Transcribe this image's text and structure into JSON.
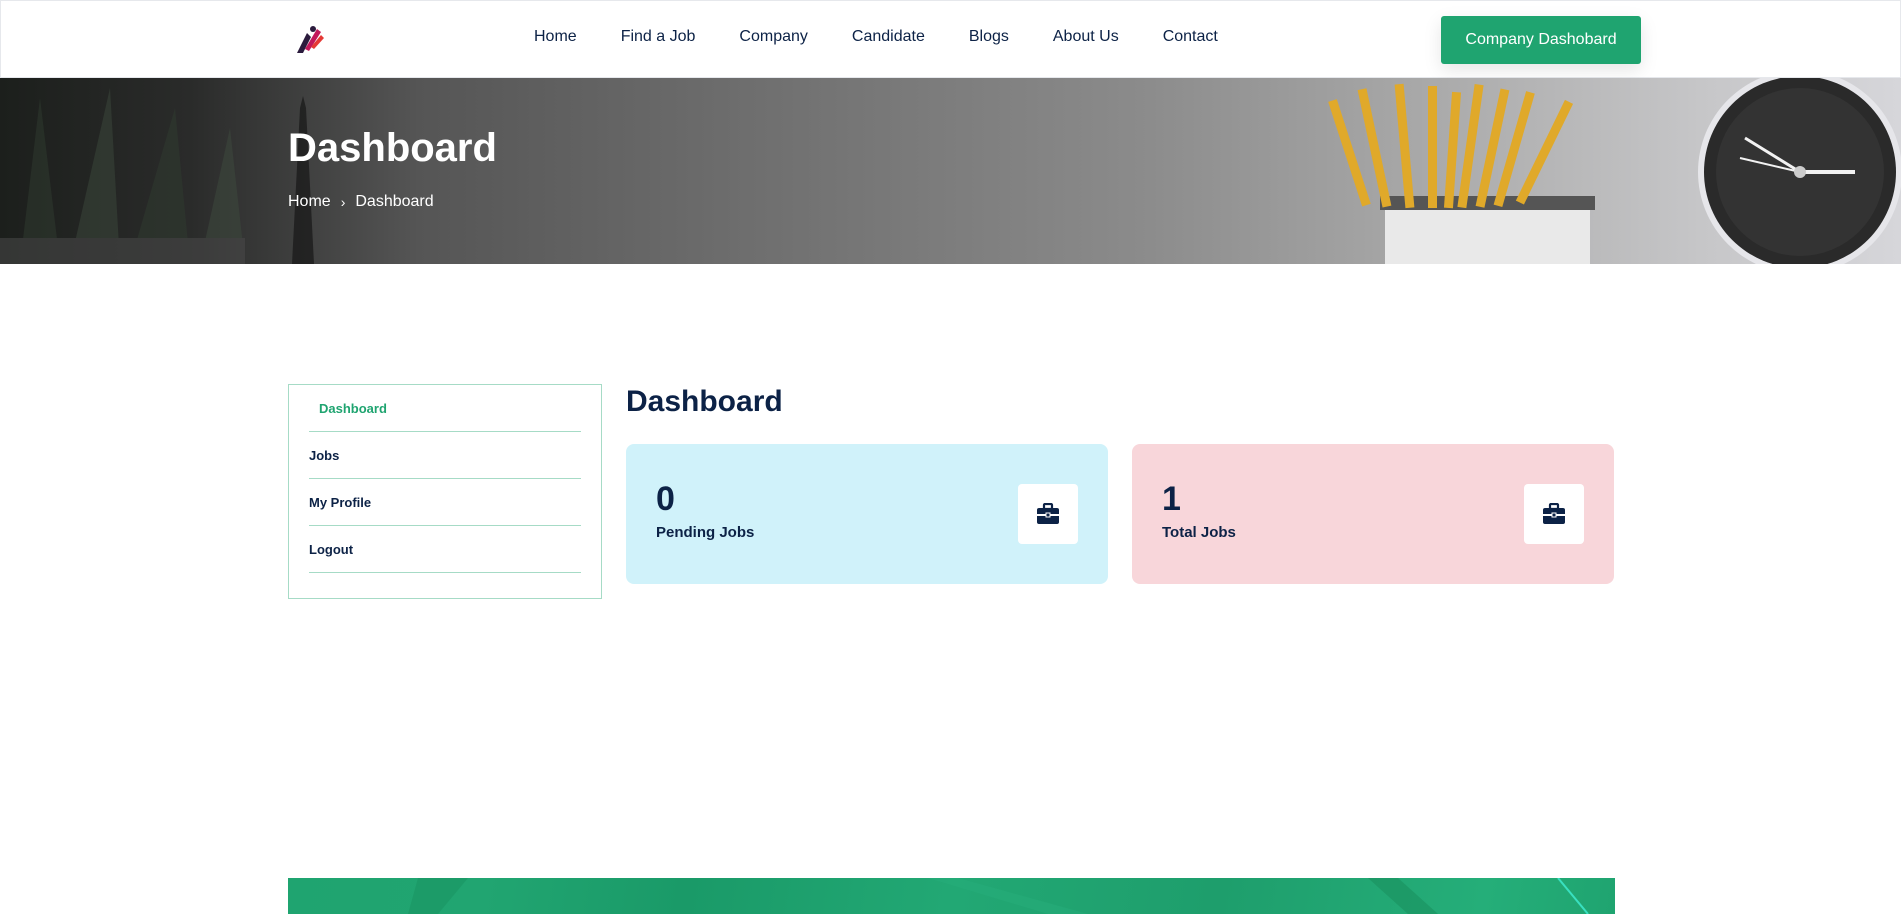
{
  "header": {
    "nav": [
      "Home",
      "Find a Job",
      "Company",
      "Candidate",
      "Blogs",
      "About Us",
      "Contact"
    ],
    "cta_label": "Company Dashobard"
  },
  "banner": {
    "title": "Dashboard",
    "breadcrumb": {
      "home": "Home",
      "current": "Dashboard"
    }
  },
  "sidebar": {
    "items": [
      {
        "label": "Dashboard",
        "active": true
      },
      {
        "label": "Jobs"
      },
      {
        "label": "My Profile"
      },
      {
        "label": "Logout"
      }
    ]
  },
  "main": {
    "title": "Dashboard",
    "cards": [
      {
        "value": "0",
        "label": "Pending Jobs",
        "icon": "briefcase-icon",
        "color": "#d0f2fa"
      },
      {
        "value": "1",
        "label": "Total Jobs",
        "icon": "briefcase-icon",
        "color": "#f8d6da"
      }
    ]
  },
  "colors": {
    "accent": "#1fa470",
    "text": "#0c2246"
  }
}
